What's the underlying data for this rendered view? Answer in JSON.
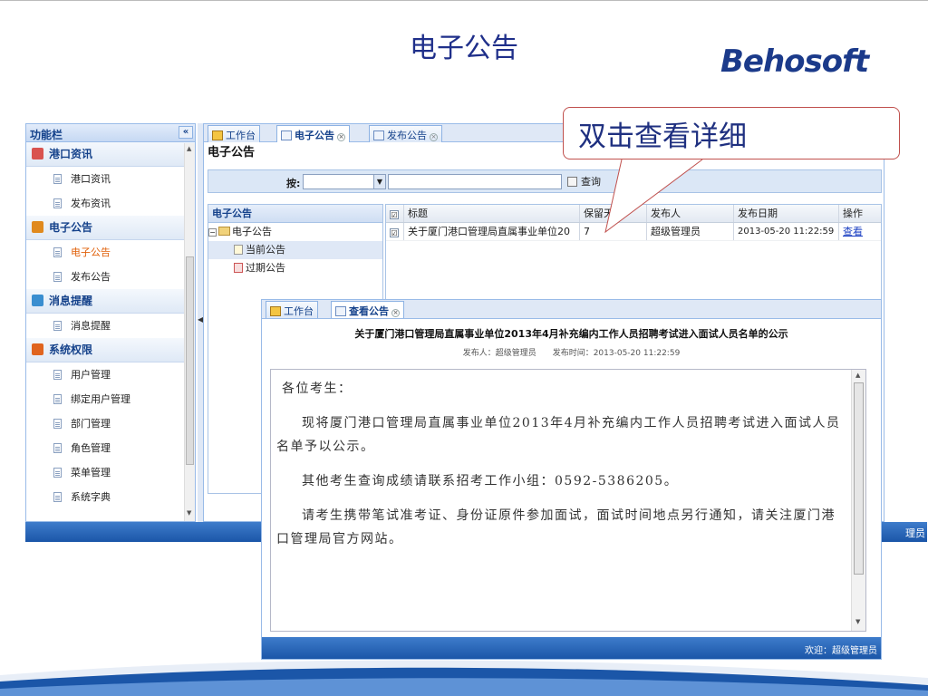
{
  "slide": {
    "title": "电子公告",
    "logo": "Behosoft"
  },
  "callout": {
    "text": "双击查看详细"
  },
  "sidebar": {
    "header": "功能栏",
    "collapse": "«",
    "groups": [
      {
        "label": "港口资讯",
        "color": "#d9534f",
        "items": [
          {
            "label": "港口资讯"
          },
          {
            "label": "发布资讯"
          }
        ]
      },
      {
        "label": "电子公告",
        "color": "#e08a1e",
        "items": [
          {
            "label": "电子公告"
          },
          {
            "label": "发布公告"
          }
        ]
      },
      {
        "label": "消息提醒",
        "color": "#3a8ed0",
        "items": [
          {
            "label": "消息提醒"
          }
        ]
      },
      {
        "label": "系统权限",
        "color": "#e0641e",
        "items": [
          {
            "label": "用户管理"
          },
          {
            "label": "绑定用户管理"
          },
          {
            "label": "部门管理"
          },
          {
            "label": "角色管理"
          },
          {
            "label": "菜单管理"
          },
          {
            "label": "系统字典"
          }
        ]
      }
    ],
    "active_item": "电子公告"
  },
  "main": {
    "tabs": [
      {
        "label": "工作台"
      },
      {
        "label": "电子公告"
      },
      {
        "label": "发布公告"
      }
    ],
    "page_heading": "电子公告",
    "query": {
      "label": "按:",
      "select_value": "",
      "input_value": "",
      "button": "查询"
    },
    "tree": {
      "header": "电子公告",
      "root": "电子公告",
      "nodes": [
        {
          "label": "当前公告"
        },
        {
          "label": "过期公告"
        }
      ]
    },
    "grid": {
      "columns": [
        "标题",
        "保留天数",
        "发布人",
        "发布日期",
        "操作"
      ],
      "rows": [
        {
          "title": "关于厦门港口管理局直属事业单位20",
          "days": "7",
          "publisher": "超级管理员",
          "date": "2013-05-20 11:22:59",
          "action": "查看",
          "checked": "☑"
        }
      ],
      "head_check": "☑"
    }
  },
  "footer": {
    "right_text": "理员"
  },
  "dialog": {
    "tabs": [
      {
        "label": "工作台"
      },
      {
        "label": "查看公告"
      }
    ],
    "title": "关于厦门港口管理局直属事业单位2013年4月补充编内工作人员招聘考试进入面试人员名单的公示",
    "meta": "发布人：超级管理员　　发布时间：2013-05-20 11:22:59",
    "body": {
      "greeting": "各位考生：",
      "p1": "现将厦门港口管理局直属事业单位2013年4月补充编内工作人员招聘考试进入面试人员名单予以公示。",
      "p2": "其他考生查询成绩请联系招考工作小组：0592-5386205。",
      "p3": "请考生携带笔试准考证、身份证原件参加面试，面试时间地点另行通知，请关注厦门港口管理局官方网站。"
    },
    "footer": "欢迎：超级管理员"
  }
}
